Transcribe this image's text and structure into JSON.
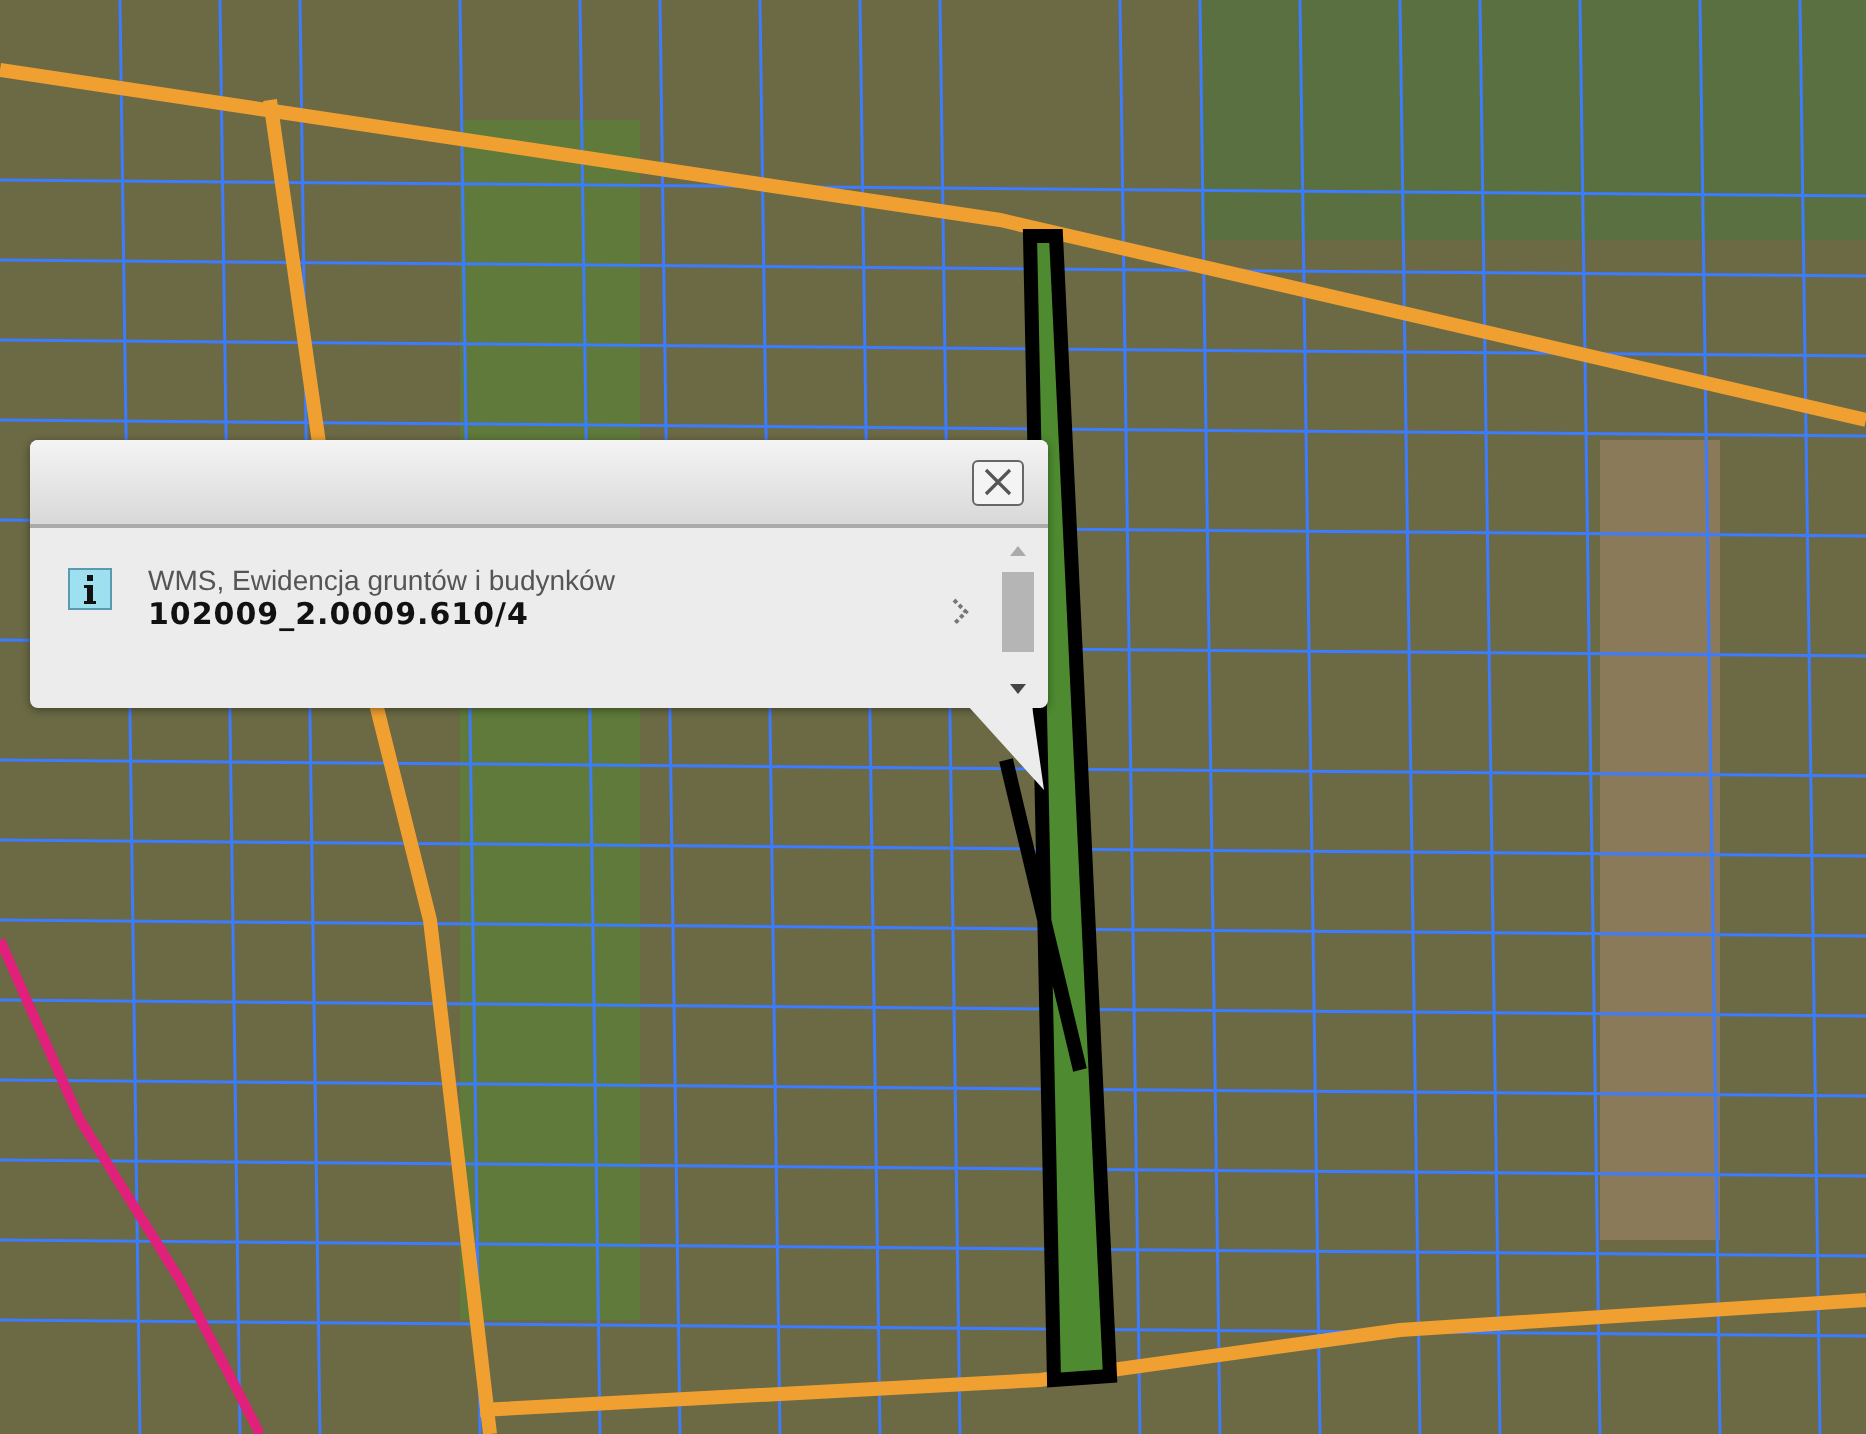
{
  "popup": {
    "source": "WMS, Ewidencja gruntów i budynków",
    "parcel_id": "102009_2.0009.610/4"
  }
}
